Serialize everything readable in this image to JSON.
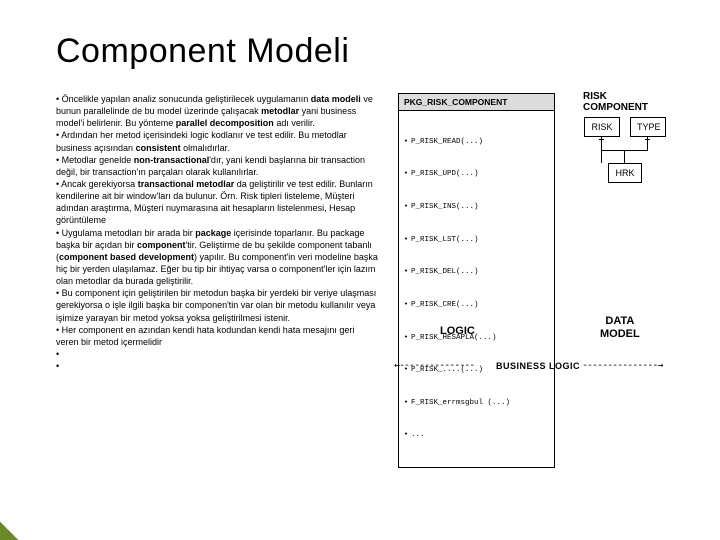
{
  "title": "Component Modeli",
  "paragraphs": {
    "p1a": "• Öncelikle yapılan analiz sonucunda geliştirilecek uygulamanın ",
    "p1b": "data modeli",
    "p1c": " ve bunun parallelinde de bu model üzerinde çalışacak ",
    "p1d": "metodlar",
    "p1e": " yani business model'i belirlenir. Bu yönteme ",
    "p1f": "parallel decomposition",
    "p1g": " adı verilir.",
    "p2a": "• Ardından her metod içerisindeki logic kodlanır ve test edilir. Bu metodlar business açısından ",
    "p2b": "consistent",
    "p2c": " olmalıdırlar.",
    "p3a": "• Metodlar genelde ",
    "p3b": "non-transactional",
    "p3c": "'dır, yani kendi başlarına bir transaction değil, bir transaction'ın parçaları olarak kullanılırlar.",
    "p4a": "• Ancak gerekiyorsa ",
    "p4b": "transactional metodlar",
    "p4c": " da geliştirilir ve test edilir. Bunların kendilerine ait bir window'ları da bulunur. Örn. Risk tipleri listeleme, Müşteri adından araştırma, Müşteri nuymarasına ait hesapların listelenmesi, Hesap görüntüleme",
    "p5a": "• Uygulama metodları bir arada bir ",
    "p5b": "package",
    "p5c": " içerisinde toparlanır.",
    "p6a": "Bu package başka bir açıdan bir ",
    "p6b": "component",
    "p6c": "'tir. Geliştirme de bu şekilde component tabanlı (",
    "p6d": "component based development",
    "p6e": ") yapılır. Bu component'in veri modeline başka hiç bir yerden ulaşılamaz. Eğer bu tip bir ihtiyaç varsa o component'ler için lazım olan metodlar da burada geliştirilir.",
    "p7": "• Bu component için geliştirilen bir metodun başka bir yerdeki bir veriye ulaşması gerekiyorsa o işle ilgili başka bir componen'tin var olan bir metodu kullanılır veya işimize yarayan bir metod yoksa yoksa geliştirilmesi istenir.",
    "p8": "• Her component en azından kendi hata kodundan kendi hata mesajını geri veren bir metod içermelidir",
    "p9": "•",
    "p10": "•"
  },
  "pkg": {
    "title": "PKG_RISK_COMPONENT",
    "rows": [
      "P_RISK_READ(...)",
      "P_RISK_UPD(...)",
      "P_RISK_INS(...)",
      "P_RISK_LST(...)",
      "P_RISK_DEL(...)",
      "P_RISK_CRE(...)",
      "P_RISK_HESAPLA(...)",
      "P_RISK_....(...)",
      "F_RISK_errmsgbul (...)",
      "..."
    ]
  },
  "labels": {
    "risk_component": "RISK COMPONENT",
    "risk": "RISK",
    "type": "TYPE",
    "hrk": "HRK",
    "logic": "LOGIC",
    "data_model_l1": "DATA",
    "data_model_l2": "MODEL",
    "business_logic": "BUSINESS LOGIC",
    "arrow_left": "←---------------",
    "arrow_right": "---------------→"
  }
}
